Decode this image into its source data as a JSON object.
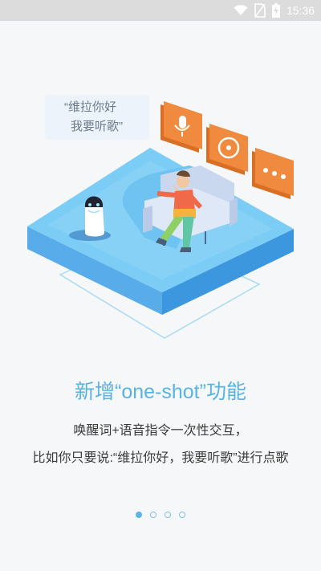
{
  "status_bar": {
    "time": "15:36",
    "icons": [
      "wifi-icon",
      "no-sim-icon",
      "battery-charging-icon"
    ]
  },
  "illustration": {
    "speech_line1": "“维拉你好",
    "speech_line2": "我要听歌”",
    "action_icons": [
      "microphone-icon",
      "music-disc-icon",
      "more-dots-icon"
    ],
    "accent_orange": "#f08a3e",
    "accent_blue": "#5cb4ec"
  },
  "content": {
    "title": "新增“one-shot”功能",
    "desc_line1": "唤醒词+语音指令一次性交互，",
    "desc_line2": "比如你只要说:“维拉你好，我要听歌”进行点歌"
  },
  "pager": {
    "total": 4,
    "active": 1
  }
}
